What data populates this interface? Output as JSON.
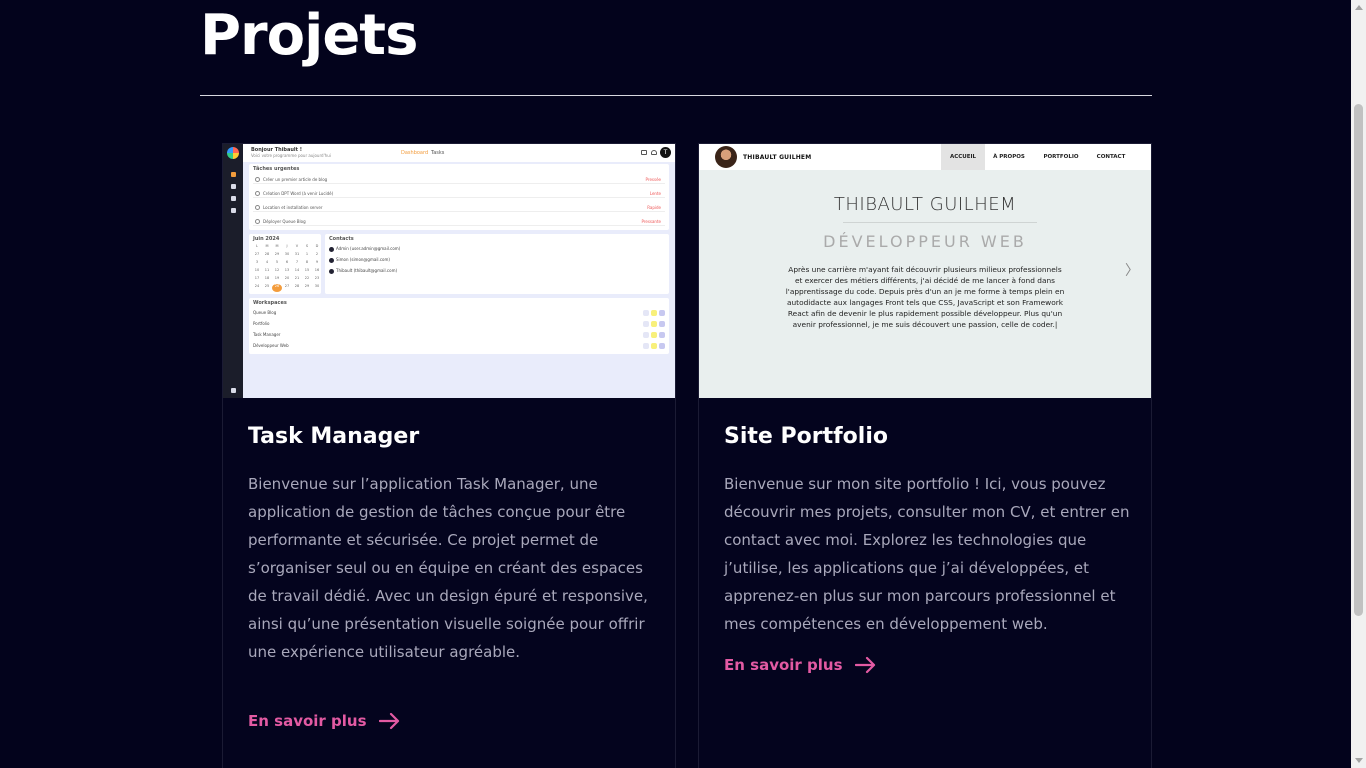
{
  "section": {
    "title": "Projets"
  },
  "projects": [
    {
      "title": "Task Manager",
      "description": "Bienvenue sur l’application Task Manager, une application de gestion de tâches conçue pour être performante et sécurisée. Ce projet permet de s’organiser seul ou en équipe en créant des espaces de travail dédié. Avec un design épuré et responsive, ainsi qu’une présentation visuelle soignée pour offrir une expérience utilisateur agréable.",
      "link_label": "En savoir plus",
      "preview": {
        "greeting": "Bonjour Thibault !",
        "subtitle": "Voici votre programme pour aujourd'hui",
        "nav": [
          "Dashboard",
          "Tasks"
        ],
        "avatar_initial": "T",
        "urgent_title": "Tâches urgentes",
        "tasks": [
          {
            "label": "Créer un premier article de blog",
            "priority": "Pressée"
          },
          {
            "label": "Création DPT Word (à venir Lucidé)",
            "priority": "Lente"
          },
          {
            "label": "Location et installation server",
            "priority": "Rapide"
          },
          {
            "label": "Déployer Queue Blog",
            "priority": "Pressante"
          }
        ],
        "calendar_title": "Juin 2024",
        "calendar_days": [
          "L",
          "M",
          "M",
          "J",
          "V",
          "S",
          "D",
          "27",
          "28",
          "29",
          "30",
          "31",
          "1",
          "2",
          "3",
          "4",
          "5",
          "6",
          "7",
          "8",
          "9",
          "10",
          "11",
          "12",
          "13",
          "14",
          "15",
          "16",
          "17",
          "18",
          "19",
          "20",
          "21",
          "22",
          "23",
          "24",
          "25",
          "26",
          "27",
          "28",
          "29",
          "30"
        ],
        "calendar_today": "26",
        "contacts_title": "Contacts",
        "contacts": [
          "Admin (user.admin@gmail.com)",
          "Simon (simon@gmail.com)",
          "Thibault (thibault@gmail.com)"
        ],
        "workspaces_title": "Workspaces",
        "workspaces": [
          "Queue Blog",
          "Portfolio",
          "Task Manager",
          "Développeur Web"
        ]
      }
    },
    {
      "title": "Site Portfolio",
      "description": "Bienvenue sur mon site portfolio ! Ici, vous pouvez découvrir mes projets, consulter mon CV, et entrer en contact avec moi. Explorez les technologies que j’utilise, les applications que j’ai développées, et apprenez-en plus sur mon parcours professionnel et mes compétences en développement web.",
      "link_label": "En savoir plus",
      "preview": {
        "brand": "THIBAULT GUILHEM",
        "nav": [
          "ACCUEIL",
          "À PROPOS",
          "PORTFOLIO",
          "CONTACT"
        ],
        "name": "THIBAULT GUILHEM",
        "role": "DÉVELOPPEUR WEB",
        "text": "Après une carrière m'ayant fait découvrir plusieurs milieux professionnels et exercer des métiers différents, j'ai décidé de me lancer à fond dans l'apprentissage du code. Depuis près d'un an je me forme à temps plein en autodidacte aux langages Front tels que CSS, JavaScript et son Framework React afin de devenir le plus rapidement possible développeur. Plus qu'un avenir professionnel, je me suis découvert une passion, celle de coder.|",
        "chevron": "〉"
      }
    }
  ],
  "colors": {
    "background": "#03031c",
    "accent": "#e35aa3",
    "text_muted": "#a9a8bb"
  },
  "icons": {
    "link_arrow": "arrow-right-icon"
  }
}
